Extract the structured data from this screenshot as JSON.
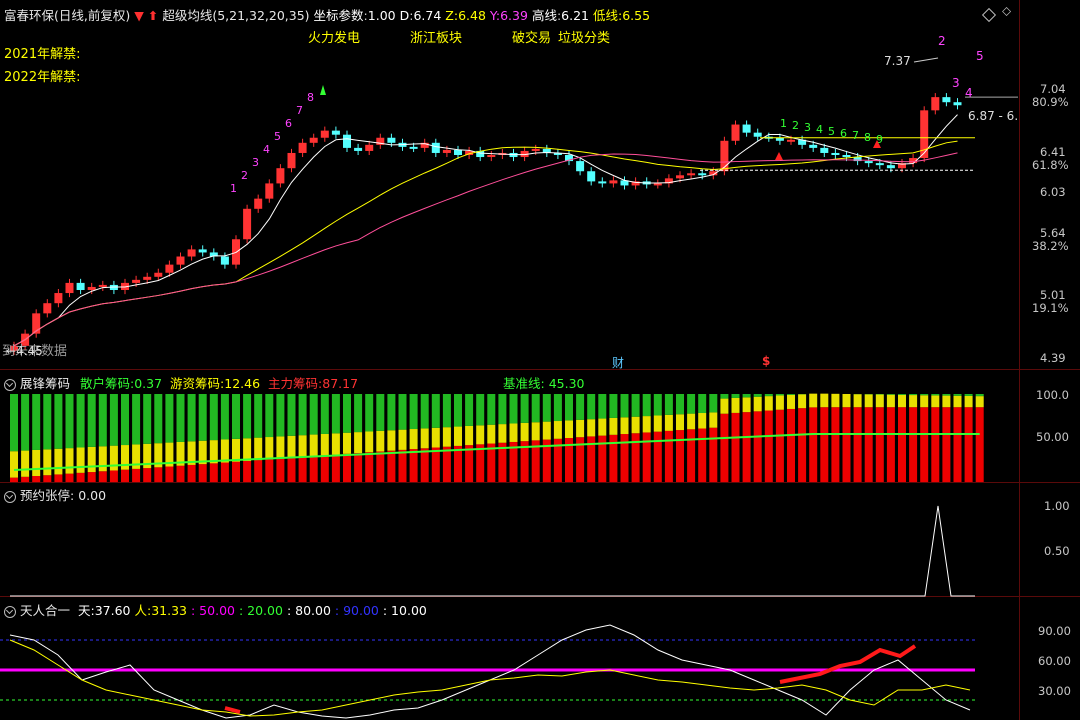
{
  "main": {
    "stock_name": "富春环保",
    "period_mode": "(日线,前复权)",
    "indicator": "超级均线(5,21,32,20,35)",
    "coord_label": "坐标参数",
    "coord_value": "1.00",
    "d_label": "D",
    "d_value": "6.74",
    "z_label": "Z",
    "z_value": "6.48",
    "y_label": "Y",
    "y_value": "6.39",
    "high_label": "高线",
    "high_value": "6.21",
    "low_label": "低线",
    "low_value": "6.55",
    "tags": [
      "火力发电",
      "浙江板块",
      "破交易",
      "垃圾分类"
    ],
    "unlock_2021": "2021年解禁:",
    "unlock_2022": "2022年解禁:",
    "future_data": "到未来数据",
    "low_price": "4.45",
    "peak_price": "7.37",
    "last_price": "6.87 - 6.",
    "fin_badge": "财",
    "dollar_badge": "$",
    "y_ticks": [
      "7.04",
      "6.41",
      "6.03",
      "5.64",
      "5.01",
      "4.39"
    ],
    "y_pcts": [
      "80.9%",
      "61.8%",
      "38.2%",
      "19.1%"
    ],
    "candle_marks_left": [
      "1",
      "2",
      "3",
      "4",
      "5",
      "6",
      "7",
      "8"
    ],
    "candle_marks_right": [
      "1",
      "2",
      "3",
      "4",
      "5",
      "6",
      "7",
      "8",
      "9"
    ],
    "peak_marks": [
      "2",
      "3",
      "4",
      "5"
    ]
  },
  "chips": {
    "title": "展锋筹码",
    "retail_label": "散户筹码:",
    "retail_value": "0.37",
    "hot_label": "游资筹码:",
    "hot_value": "12.46",
    "main_label": "主力筹码:",
    "main_value": "87.17",
    "base_label": "基准线:",
    "base_value": "45.30",
    "y_ticks": [
      "100.0",
      "50.00"
    ]
  },
  "limit": {
    "title": "预约张停",
    "value": ": 0.00",
    "y_ticks": [
      "1.00",
      "0.50"
    ]
  },
  "tianren": {
    "title": "天人合一",
    "tian_label": "天:",
    "tian_value": "37.60",
    "ren_label": "人:",
    "ren_value": "31.33",
    "v50": ": 50.00",
    "v20": ": 20.00",
    "v80": ": 80.00",
    "v90": ": 90.00",
    "v10": ": 10.00",
    "v50_raw": "50.00",
    "y_ticks": [
      "90.00",
      "60.00",
      "30.00"
    ]
  },
  "colors": {
    "up": "#ff3333",
    "down": "#54ffff",
    "ma_white": "#ffffff",
    "ma_yellow": "#ffff00",
    "ma_pink": "#ff00ff",
    "green": "#33ff33"
  }
}
